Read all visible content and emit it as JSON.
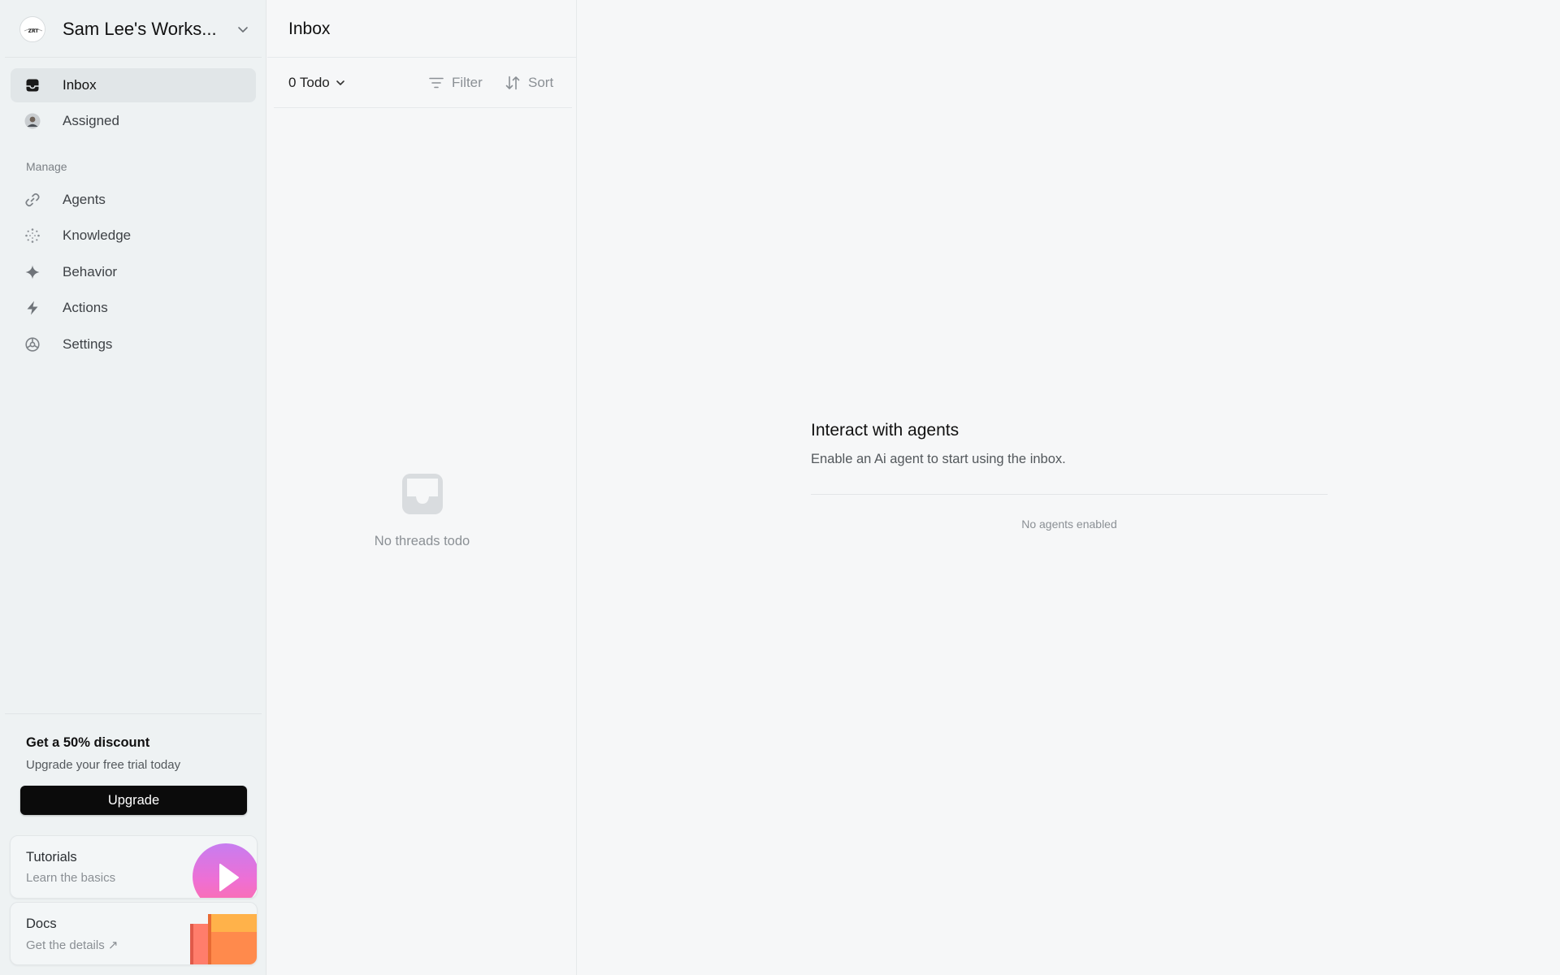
{
  "workspace": {
    "name": "Sam Lee's Works...",
    "logo_text": "ZRT"
  },
  "nav": {
    "primary": [
      {
        "label": "Inbox",
        "icon": "inbox-icon",
        "active": true
      },
      {
        "label": "Assigned",
        "icon": "user-avatar-icon",
        "active": false
      }
    ],
    "section_label": "Manage",
    "manage": [
      {
        "label": "Agents",
        "icon": "link-icon"
      },
      {
        "label": "Knowledge",
        "icon": "dots-circle-icon"
      },
      {
        "label": "Behavior",
        "icon": "sparkle-icon"
      },
      {
        "label": "Actions",
        "icon": "lightning-icon"
      },
      {
        "label": "Settings",
        "icon": "settings-wheel-icon"
      }
    ]
  },
  "promo": {
    "title": "Get a 50% discount",
    "subtitle": "Upgrade your free trial today",
    "button_label": "Upgrade"
  },
  "cards": {
    "tutorials": {
      "title": "Tutorials",
      "subtitle": "Learn the basics",
      "icon": "play-icon"
    },
    "docs": {
      "title": "Docs",
      "subtitle": "Get the details ↗",
      "icon": "manual-books-icon"
    }
  },
  "list_panel": {
    "title": "Inbox",
    "todo_label": "0 Todo",
    "filter_label": "Filter",
    "sort_label": "Sort",
    "empty_text": "No threads todo"
  },
  "main": {
    "title": "Interact with agents",
    "subtitle": "Enable an Ai agent to start using the inbox.",
    "empty_text": "No agents enabled"
  },
  "colors": {
    "sidebar_bg": "#eef2f3",
    "active_item_bg": "#e1e6e8",
    "upgrade_button": "#0b0b0b",
    "tutorial_gradient_top": "#c77df0",
    "tutorial_gradient_bottom": "#ff6fa6",
    "docs_orange": "#ff8a4c"
  }
}
